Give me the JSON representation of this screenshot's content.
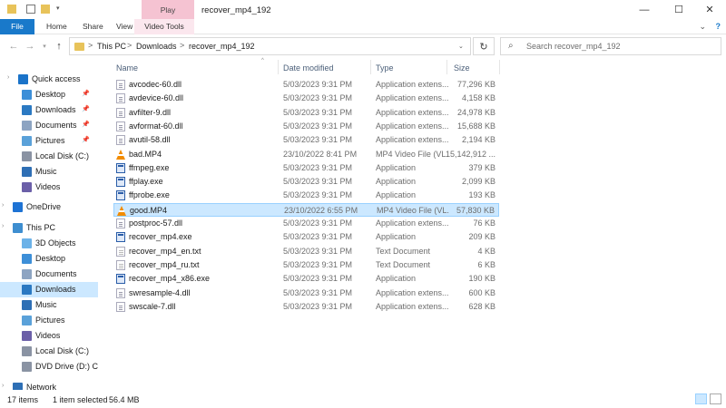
{
  "window": {
    "title": "recover_mp4_192",
    "contextual_tab": "Play",
    "controls": {
      "minimize": "—",
      "maximize": "☐",
      "close": "✕"
    }
  },
  "ribbon": {
    "file": "File",
    "tabs": [
      "Home",
      "Share",
      "View",
      "Video Tools"
    ],
    "expand_icon": "⌄",
    "help_icon": "?"
  },
  "address": {
    "crumbs": [
      "This PC",
      "Downloads",
      "recover_mp4_192"
    ],
    "separator": ">",
    "refresh_icon": "↻"
  },
  "search": {
    "placeholder": "Search recover_mp4_192",
    "icon": "⌕"
  },
  "nav": [
    {
      "label": "Quick access",
      "icon": "star-icon",
      "color": "#1a73c9"
    },
    {
      "label": "Desktop",
      "icon": "desktop-icon",
      "color": "#3d8fd8",
      "pinned": true
    },
    {
      "label": "Downloads",
      "icon": "download-icon",
      "color": "#2b79c2",
      "pinned": true
    },
    {
      "label": "Documents",
      "icon": "documents-icon",
      "color": "#8da4c2",
      "pinned": true
    },
    {
      "label": "Pictures",
      "icon": "pictures-icon",
      "color": "#5aa1d9",
      "pinned": true
    },
    {
      "label": "Local Disk (C:)",
      "icon": "drive-icon",
      "color": "#8a93a3"
    },
    {
      "label": "Music",
      "icon": "music-icon",
      "color": "#2e6fb5"
    },
    {
      "label": "Videos",
      "icon": "videos-icon",
      "color": "#6b5fa8"
    },
    {
      "label": "OneDrive",
      "icon": "cloud-icon",
      "color": "#1e73d4"
    },
    {
      "label": "This PC",
      "icon": "computer-icon",
      "color": "#3e8ed0"
    },
    {
      "label": "3D Objects",
      "icon": "cube-icon",
      "color": "#6cb2e8"
    },
    {
      "label": "Desktop",
      "icon": "desktop-icon",
      "color": "#3d8fd8"
    },
    {
      "label": "Documents",
      "icon": "documents-icon",
      "color": "#8da4c2"
    },
    {
      "label": "Downloads",
      "icon": "download-icon",
      "color": "#2b79c2",
      "selected": true
    },
    {
      "label": "Music",
      "icon": "music-icon",
      "color": "#2e6fb5"
    },
    {
      "label": "Pictures",
      "icon": "pictures-icon",
      "color": "#5aa1d9"
    },
    {
      "label": "Videos",
      "icon": "videos-icon",
      "color": "#6b5fa8"
    },
    {
      "label": "Local Disk (C:)",
      "icon": "drive-icon",
      "color": "#8a93a3"
    },
    {
      "label": "DVD Drive (D:) C",
      "icon": "dvd-icon",
      "color": "#8a93a3"
    },
    {
      "label": "Network",
      "icon": "network-icon",
      "color": "#2e6fb5"
    }
  ],
  "columns": {
    "name": "Name",
    "date": "Date modified",
    "type": "Type",
    "size": "Size"
  },
  "files": [
    {
      "name": "avcodec-60.dll",
      "date": "5/03/2023 9:31 PM",
      "type": "Application extens...",
      "size": "77,296 KB",
      "kind": "dll"
    },
    {
      "name": "avdevice-60.dll",
      "date": "5/03/2023 9:31 PM",
      "type": "Application extens...",
      "size": "4,158 KB",
      "kind": "dll"
    },
    {
      "name": "avfilter-9.dll",
      "date": "5/03/2023 9:31 PM",
      "type": "Application extens...",
      "size": "24,978 KB",
      "kind": "dll"
    },
    {
      "name": "avformat-60.dll",
      "date": "5/03/2023 9:31 PM",
      "type": "Application extens...",
      "size": "15,688 KB",
      "kind": "dll"
    },
    {
      "name": "avutil-58.dll",
      "date": "5/03/2023 9:31 PM",
      "type": "Application extens...",
      "size": "2,194 KB",
      "kind": "dll"
    },
    {
      "name": "bad.MP4",
      "date": "23/10/2022 8:41 PM",
      "type": "MP4 Video File (VL...",
      "size": "15,142,912 ...",
      "kind": "vlc"
    },
    {
      "name": "ffmpeg.exe",
      "date": "5/03/2023 9:31 PM",
      "type": "Application",
      "size": "379 KB",
      "kind": "exe"
    },
    {
      "name": "ffplay.exe",
      "date": "5/03/2023 9:31 PM",
      "type": "Application",
      "size": "2,099 KB",
      "kind": "exe"
    },
    {
      "name": "ffprobe.exe",
      "date": "5/03/2023 9:31 PM",
      "type": "Application",
      "size": "193 KB",
      "kind": "exe"
    },
    {
      "name": "good.MP4",
      "date": "23/10/2022 6:55 PM",
      "type": "MP4 Video File (VL...",
      "size": "57,830 KB",
      "kind": "vlc",
      "selected": true
    },
    {
      "name": "postproc-57.dll",
      "date": "5/03/2023 9:31 PM",
      "type": "Application extens...",
      "size": "76 KB",
      "kind": "dll"
    },
    {
      "name": "recover_mp4.exe",
      "date": "5/03/2023 9:31 PM",
      "type": "Application",
      "size": "209 KB",
      "kind": "exe"
    },
    {
      "name": "recover_mp4_en.txt",
      "date": "5/03/2023 9:31 PM",
      "type": "Text Document",
      "size": "4 KB",
      "kind": "txt"
    },
    {
      "name": "recover_mp4_ru.txt",
      "date": "5/03/2023 9:31 PM",
      "type": "Text Document",
      "size": "6 KB",
      "kind": "txt"
    },
    {
      "name": "recover_mp4_x86.exe",
      "date": "5/03/2023 9:31 PM",
      "type": "Application",
      "size": "190 KB",
      "kind": "exe"
    },
    {
      "name": "swresample-4.dll",
      "date": "5/03/2023 9:31 PM",
      "type": "Application extens...",
      "size": "600 KB",
      "kind": "dll"
    },
    {
      "name": "swscale-7.dll",
      "date": "5/03/2023 9:31 PM",
      "type": "Application extens...",
      "size": "628 KB",
      "kind": "dll"
    }
  ],
  "status": {
    "count": "17 items",
    "selection": "1 item selected",
    "size": "56.4 MB"
  },
  "colors": {
    "accent": "#1979ca",
    "selection": "#cce8ff",
    "contextual": "#f5c3d2"
  }
}
